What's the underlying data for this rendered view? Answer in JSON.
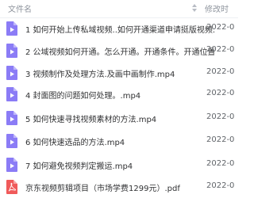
{
  "header": {
    "name_label": "文件名",
    "modified_label": "修改时"
  },
  "files": [
    {
      "name": "1 如何开始上传私域视频..如何开通渠道申请挺版视频...",
      "date": "2022-0",
      "type": "video"
    },
    {
      "name": "2 公域视频如何开通。怎么开通。开通条件。开通位置。..",
      "date": "2022-0",
      "type": "video"
    },
    {
      "name": "3 视频制作及处理方法.及画中画制作.mp4",
      "date": "2022-0",
      "type": "video"
    },
    {
      "name": "4 封面图的问题如何处理。.mp4",
      "date": "2022-0",
      "type": "video"
    },
    {
      "name": "5 如何快速寻找视频素材的方法.mp4",
      "date": "2022-0",
      "type": "video"
    },
    {
      "name": "6 如何快速选品的方法.mp4",
      "date": "2022-0",
      "type": "video"
    },
    {
      "name": "7 如何避免视频判定搬运.mp4",
      "date": "2022-0",
      "type": "video"
    },
    {
      "name": "京东视频剪辑项目（市场学费1299元）.pdf",
      "date": "2022-0",
      "type": "pdf"
    }
  ],
  "colors": {
    "video_icon": "#8b7cf6",
    "pdf_icon": "#f05a5a"
  }
}
